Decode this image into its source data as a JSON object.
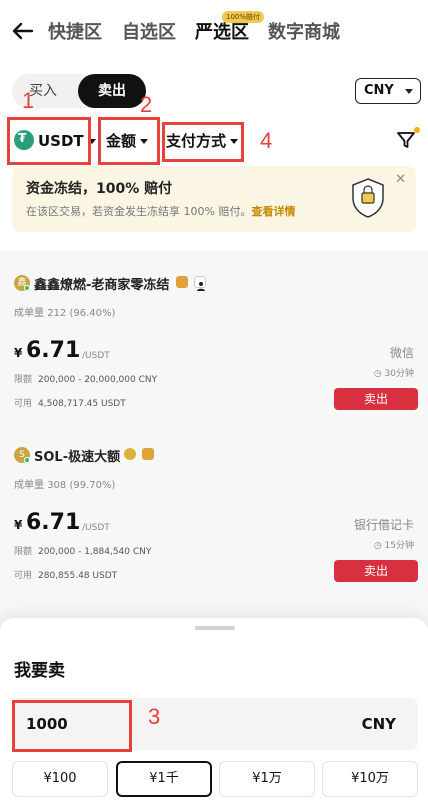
{
  "header": {
    "tabs": [
      "快捷区",
      "自选区",
      "严选区",
      "数字商城"
    ],
    "active_tab_badge": "100%赔付"
  },
  "trade_toggle": {
    "buy": "买入",
    "sell": "卖出"
  },
  "currency_select": "CNY",
  "filters": {
    "coin": "USDT",
    "amount": "金额",
    "payment": "支付方式"
  },
  "annotations": [
    "1",
    "2",
    "3",
    "4"
  ],
  "banner": {
    "title": "资金冻结，100% 赔付",
    "subtitle": "在该区交易，若资金发生冻结享 100% 赔付。",
    "link": "查看详情"
  },
  "listings": [
    {
      "name": "鑫鑫燎燃-老商家零冻结",
      "avatar_char": "鑫",
      "volume_label": "成单量",
      "volume": "212 (96.40%)",
      "currency_symbol": "¥",
      "price": "6.71",
      "price_unit": "/USDT",
      "limit_label": "限额",
      "limit": "200,000 - 20,000,000 CNY",
      "available_label": "可用",
      "available": "4,508,717.45 USDT",
      "payment": "微信",
      "time": "30分钟",
      "action": "卖出"
    },
    {
      "name": "SOL-极速大额",
      "avatar_char": "S",
      "volume_label": "成单量",
      "volume": "308 (99.70%)",
      "currency_symbol": "¥",
      "price": "6.71",
      "price_unit": "/USDT",
      "limit_label": "限额",
      "limit": "200,000 - 1,884,540 CNY",
      "available_label": "可用",
      "available": "280,855.48 USDT",
      "payment": "银行借记卡",
      "time": "15分钟",
      "action": "卖出"
    }
  ],
  "sheet": {
    "title": "我要卖",
    "amount": "1000",
    "amount_currency": "CNY",
    "presets": [
      "¥100",
      "¥1千",
      "¥1万",
      "¥10万"
    ]
  },
  "colors": {
    "accent_red": "#d8303f",
    "annotation_red": "#e8413b",
    "banner_link": "#c78b00",
    "usdt_green": "#26a17b"
  }
}
